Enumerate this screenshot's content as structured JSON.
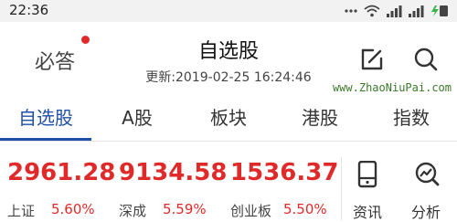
{
  "status_bar": {
    "time": "22:36",
    "icons": [
      "menu-dots-icon",
      "wifi-icon",
      "signal-icon",
      "signal-icon",
      "charging-icon"
    ]
  },
  "header": {
    "left_label": "必答",
    "title": "自选股",
    "updated": "更新:2019-02-25 16:24:46",
    "watermark": "www.ZhaoNiuPai.com",
    "icons": [
      "edit-icon",
      "search-icon"
    ]
  },
  "tabs": [
    {
      "label": "自选股",
      "active": true
    },
    {
      "label": "A股",
      "active": false
    },
    {
      "label": "板块",
      "active": false
    },
    {
      "label": "港股",
      "active": false
    },
    {
      "label": "指数",
      "active": false
    }
  ],
  "indices": [
    {
      "value": "2961.28",
      "name": "上证",
      "change": "5.60%"
    },
    {
      "value": "9134.58",
      "name": "深成",
      "change": "5.59%"
    },
    {
      "value": "1536.37",
      "name": "创业板",
      "change": "5.50%"
    }
  ],
  "side_buttons": [
    {
      "label": "资讯",
      "icon": "phone-icon"
    },
    {
      "label": "分析",
      "icon": "analysis-icon"
    }
  ],
  "colors": {
    "accent": "#1f4fa8",
    "up": "#e02a2a",
    "status_bg": "#f2f2f2"
  }
}
